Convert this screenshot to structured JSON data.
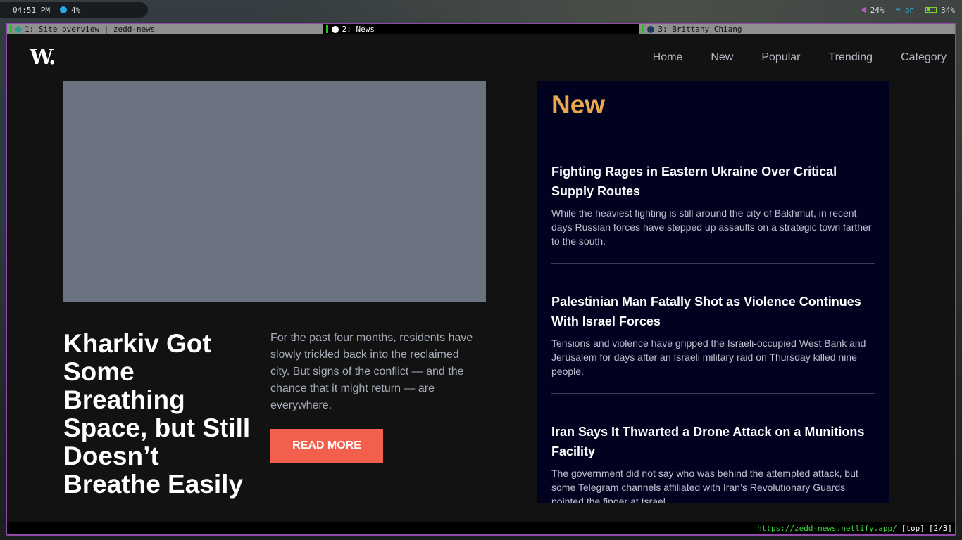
{
  "system_bar": {
    "time": "04:51 PM",
    "cpu": "4%",
    "volume": "24%",
    "wifi": "on",
    "battery": "34%"
  },
  "tabs": [
    {
      "label": "1: Site overview | zedd-news",
      "active": false
    },
    {
      "label": "2: News",
      "active": true
    },
    {
      "label": "3: Brittany Chiang",
      "active": false
    }
  ],
  "site": {
    "logo": "W.",
    "nav": [
      "Home",
      "New",
      "Popular",
      "Trending",
      "Category"
    ]
  },
  "hero": {
    "title": "Kharkiv Got Some Breathing Space, but Still Doesn’t Breathe Easily",
    "description": "For the past four months, residents have slowly trickled back into the reclaimed city. But signs of the conflict — and the chance that it might return — are everywhere.",
    "button_label": "READ MORE"
  },
  "new_section": {
    "heading": "New",
    "articles": [
      {
        "title": "Fighting Rages in Eastern Ukraine Over Critical Supply Routes",
        "summary": "While the heaviest fighting is still around the city of Bakhmut, in recent days Russian forces have stepped up assaults on a strategic town farther to the south."
      },
      {
        "title": "Palestinian Man Fatally Shot as Violence Continues With Israel Forces",
        "summary": "Tensions and violence have gripped the Israeli-occupied West Bank and Jerusalem for days after an Israeli military raid on Thursday killed nine people."
      },
      {
        "title": "Iran Says It Thwarted a Drone Attack on a Munitions Facility",
        "summary": "The government did not say who was behind the attempted attack, but some Telegram channels affiliated with Iran’s Revolutionary Guards pointed the finger at Israel."
      }
    ]
  },
  "status_bar": {
    "url": "https://zedd-news.netlify.app/",
    "scroll": "[top]",
    "tab_index": "[2/3]"
  },
  "colors": {
    "accent_orange": "#eaa74d",
    "button_red": "#f25f4c",
    "panel_navy": "#010220",
    "window_border": "#8e4aa6"
  }
}
